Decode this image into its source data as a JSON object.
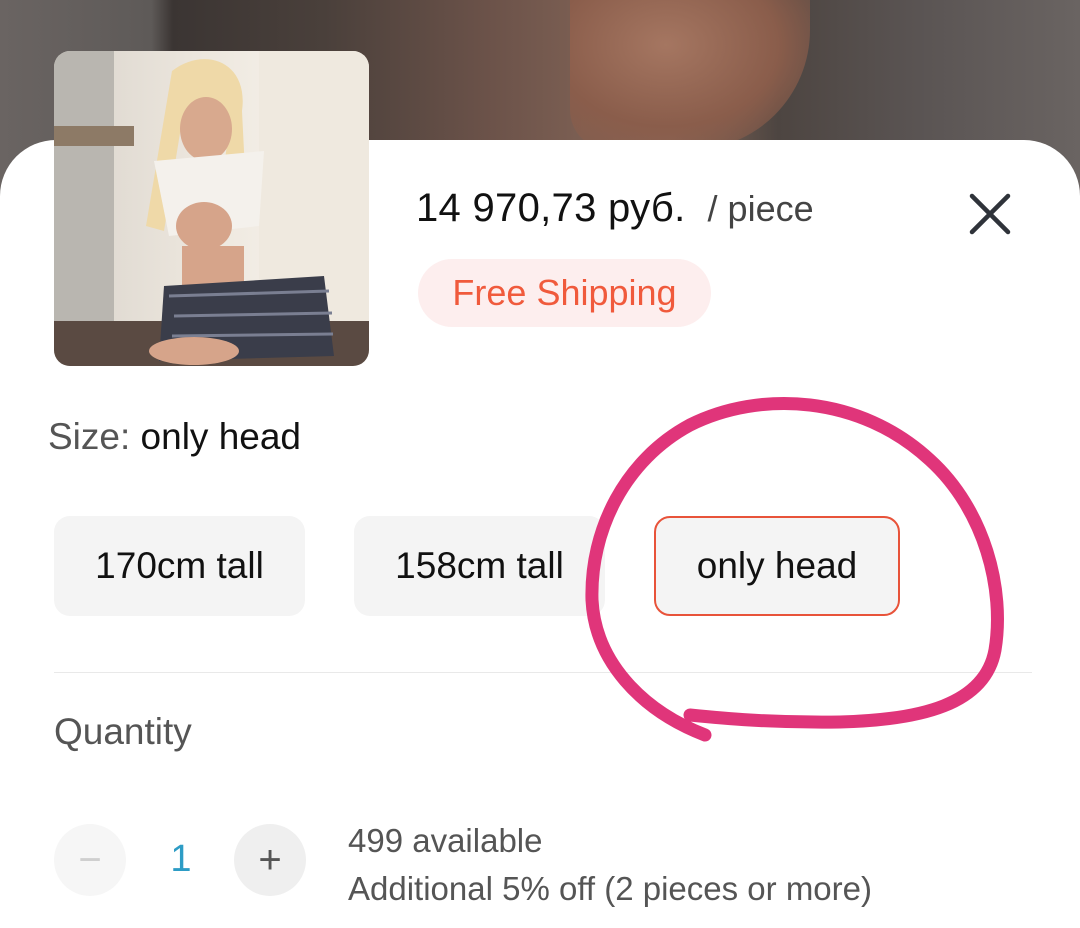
{
  "product": {
    "price": "14  970,73 руб.",
    "price_unit": "/ piece",
    "shipping_badge": "Free Shipping"
  },
  "size": {
    "label": "Size:",
    "selected": "only head",
    "options": [
      "170cm tall",
      "158cm tall",
      "only head"
    ]
  },
  "quantity": {
    "title": "Quantity",
    "value": "1",
    "minus_symbol": "−",
    "plus_symbol": "+",
    "available": "499 available",
    "discount_note": "Additional 5% off (2 pieces or more)"
  },
  "icons": [
    "close-icon",
    "minus-icon",
    "plus-icon"
  ],
  "colors": {
    "accent": "#f05a3c",
    "badge_bg": "#fdeeee",
    "selected_border": "#e8533a",
    "quantity_value": "#2d9cc5",
    "annotation_circle": "#e0357a"
  }
}
